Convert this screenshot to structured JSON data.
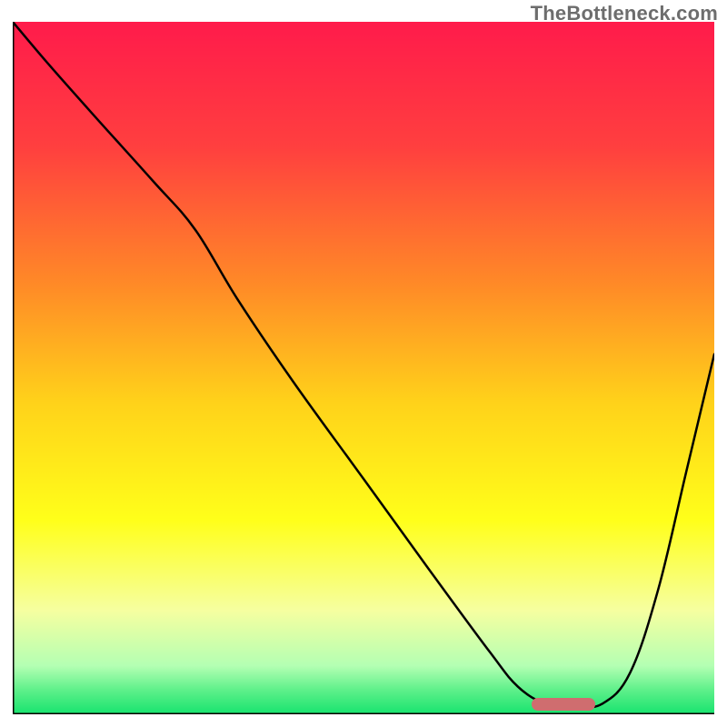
{
  "watermark": {
    "text": "TheBottleneck.com"
  },
  "chart_data": {
    "type": "line",
    "title": "",
    "xlabel": "",
    "ylabel": "",
    "xlim": [
      0,
      100
    ],
    "ylim": [
      0,
      100
    ],
    "grid": false,
    "legend": false,
    "background": {
      "type": "vertical-gradient",
      "stops": [
        {
          "offset": 0.0,
          "color": "#ff1b4b"
        },
        {
          "offset": 0.18,
          "color": "#ff3f3f"
        },
        {
          "offset": 0.38,
          "color": "#ff8a27"
        },
        {
          "offset": 0.55,
          "color": "#ffd21a"
        },
        {
          "offset": 0.72,
          "color": "#ffff1a"
        },
        {
          "offset": 0.85,
          "color": "#f6ffa0"
        },
        {
          "offset": 0.93,
          "color": "#b4ffb3"
        },
        {
          "offset": 0.965,
          "color": "#5ef08a"
        },
        {
          "offset": 1.0,
          "color": "#17e36e"
        }
      ]
    },
    "series": [
      {
        "name": "bottleneck-curve",
        "color": "#000000",
        "stroke_width": 2.5,
        "x": [
          0,
          5,
          12,
          20,
          26,
          32,
          40,
          50,
          60,
          68,
          72,
          76,
          80,
          84,
          88,
          92,
          96,
          100
        ],
        "y": [
          100,
          94,
          86,
          77,
          70,
          60,
          48,
          34,
          20,
          9,
          4,
          1.5,
          1.2,
          1.5,
          6,
          18,
          35,
          52
        ]
      }
    ],
    "annotations": [
      {
        "name": "optimal-range-marker",
        "type": "bar",
        "color": "#cf6d6f",
        "x_start": 74,
        "x_end": 83,
        "y": 1.4
      }
    ],
    "axes": {
      "left": {
        "visible": true,
        "color": "#000000",
        "width": 3
      },
      "bottom": {
        "visible": true,
        "color": "#000000",
        "width": 3
      }
    }
  }
}
